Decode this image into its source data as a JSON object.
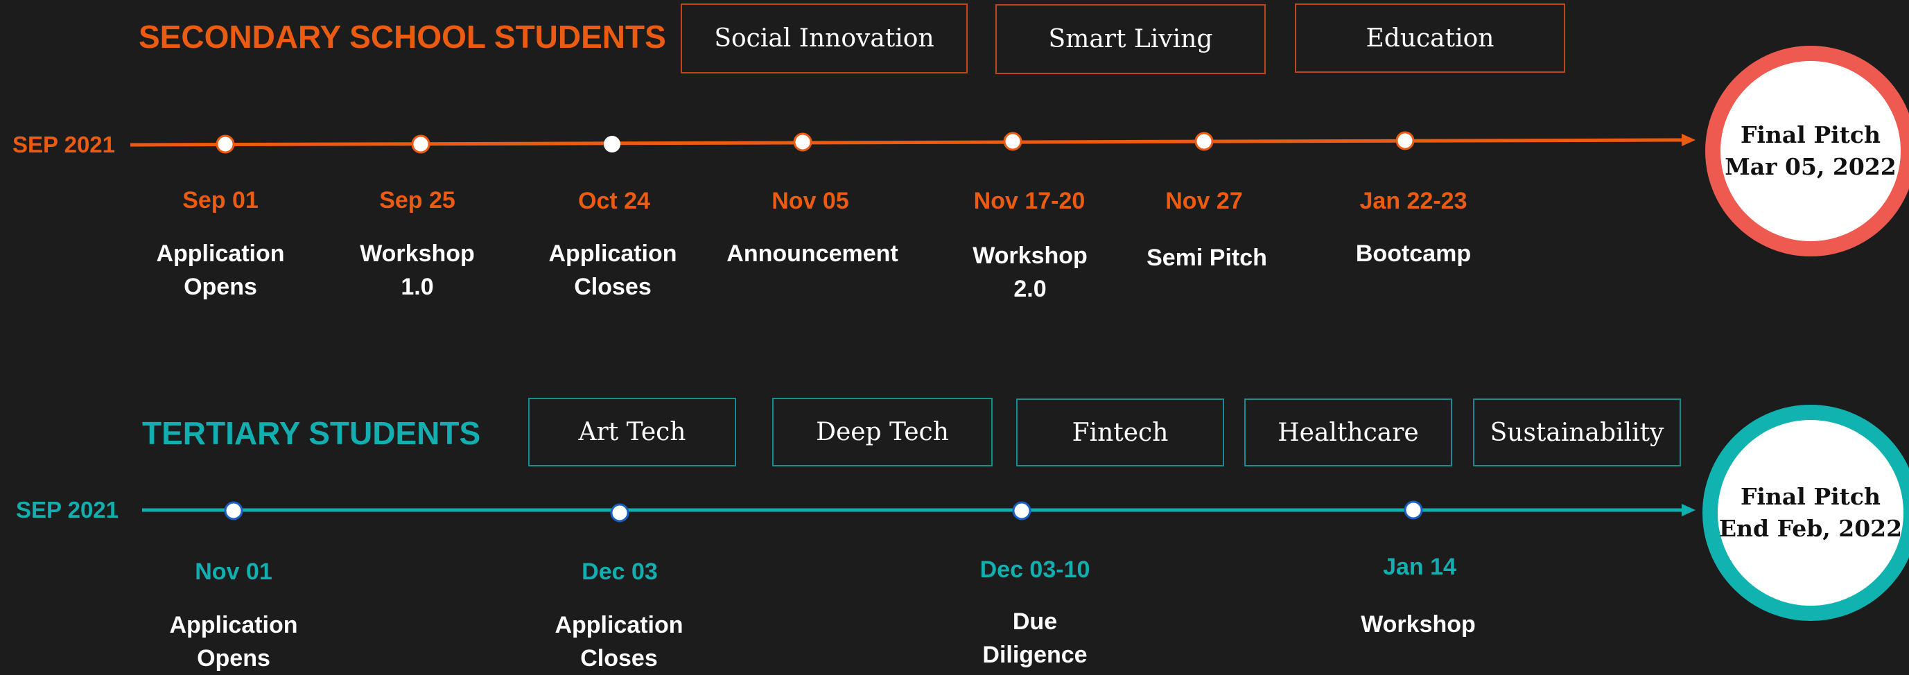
{
  "secondary": {
    "title": "SECONDARY SCHOOL STUDENTS",
    "color": "#ec5b12",
    "categories": [
      "Social Innovation",
      "Smart Living",
      "Education"
    ],
    "start_label": "SEP 2021",
    "events": [
      {
        "date": "Sep 01",
        "label": "Application\nOpens"
      },
      {
        "date": "Sep 25",
        "label": "Workshop\n1.0"
      },
      {
        "date": "Oct 24",
        "label": "Application\nCloses"
      },
      {
        "date": "Nov 05",
        "label": "Announcement"
      },
      {
        "date": "Nov 17-20",
        "label": "Workshop\n2.0"
      },
      {
        "date": "Nov 27",
        "label": "Semi Pitch"
      },
      {
        "date": "Jan 22-23",
        "label": "Bootcamp"
      }
    ],
    "final": {
      "title": "Final Pitch",
      "date": "Mar 05, 2022"
    }
  },
  "tertiary": {
    "title": "TERTIARY STUDENTS",
    "color": "#13aeb0",
    "categories": [
      "Art Tech",
      "Deep Tech",
      "Fintech",
      "Healthcare",
      "Sustainability"
    ],
    "start_label": "SEP 2021",
    "events": [
      {
        "date": "Nov 01",
        "label": "Application\nOpens"
      },
      {
        "date": "Dec 03",
        "label": "Application\nCloses"
      },
      {
        "date": "Dec 03-10",
        "label": "Due\nDiligence"
      },
      {
        "date": "Jan 14",
        "label": "Workshop"
      }
    ],
    "final": {
      "title": "Final Pitch",
      "date": "End Feb, 2022"
    }
  }
}
